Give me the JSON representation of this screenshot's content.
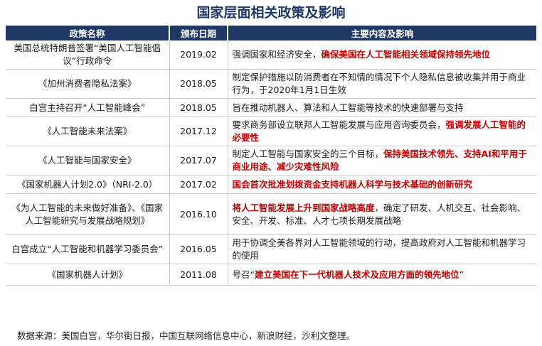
{
  "title": "国家层面相关政策及影响",
  "headers": {
    "name": "政策名称",
    "date": "颁布日期",
    "content": "主要内容及影响"
  },
  "rows": [
    {
      "name": "美国总统特朗普签署“美国人工智能倡议”行政命令",
      "date": "2019.02",
      "content": [
        {
          "text": "强调国家和经济安全，",
          "hl": false
        },
        {
          "text": "确保美国在人工智能相关领域保持领先地位",
          "hl": true
        }
      ]
    },
    {
      "name": "《加州消费者隐私法案》",
      "date": "2018.05",
      "content": [
        {
          "text": "制定保护措施以防消费者在不知情的情况下个人隐私信息被收集并用于商业行为，于2020年1月1日生效",
          "hl": false
        }
      ]
    },
    {
      "name": "白宫主持召开“人工智能峰会”",
      "date": "2018.05",
      "content": [
        {
          "text": "旨在推动机器人、算法和人工智能等技术的快速部署与支持",
          "hl": false
        }
      ]
    },
    {
      "name": "《人工智能未来法案》",
      "date": "2017.12",
      "content": [
        {
          "text": "要求商务部设立联邦人工智能发展与应用咨询委员会，",
          "hl": false
        },
        {
          "text": "强调发展人工智能的必要性",
          "hl": true
        }
      ]
    },
    {
      "name": "《人工智能与国家安全》",
      "date": "2017.07",
      "content": [
        {
          "text": "制定人工智能与国家安全的三个目标，",
          "hl": false
        },
        {
          "text": "保持美国技术领先、支持AI和平用于商业用途、减少灾难性风险",
          "hl": true
        }
      ]
    },
    {
      "name": "《国家机器人计划2.0》（NRI-2.0）",
      "date": "2017.02",
      "content": [
        {
          "text": "国会首次批准划拨资金支持机器人科学与技术基础的创新研究",
          "hl": true
        }
      ]
    },
    {
      "name": "《为人工智能的未来做好准备》、《国家人工智能研究与发展战略规划》",
      "date": "2016.10",
      "content": [
        {
          "text": "将人工智能发展上升到国家战略高度",
          "hl": true
        },
        {
          "text": "，确定了研发、人机交互、社会影响、安全、开发、标准、人才七项长期发展战略",
          "hl": false
        }
      ]
    },
    {
      "name": "白宫成立“人工智能和机器学习委员会”",
      "date": "2016.05",
      "content": [
        {
          "text": "用于协调全美各界对人工智能领域的行动，提高政府对人工智能和机器学习的使用",
          "hl": false
        }
      ]
    },
    {
      "name": "《国家机器人计划》",
      "date": "2011.08",
      "content": [
        {
          "text": "号召“",
          "hl": false
        },
        {
          "text": "建立美国在下一代机器人技术及应用方面的领先地位",
          "hl": true
        },
        {
          "text": "”",
          "hl": false
        }
      ]
    }
  ],
  "source": "数据来源：美国白宫，华尔街日报，中国互联网络信息中心，新浪财经，沙利文整理。",
  "colors": {
    "header_bg": "#1f3864",
    "highlight": "#c00000",
    "title": "#1f3864"
  }
}
